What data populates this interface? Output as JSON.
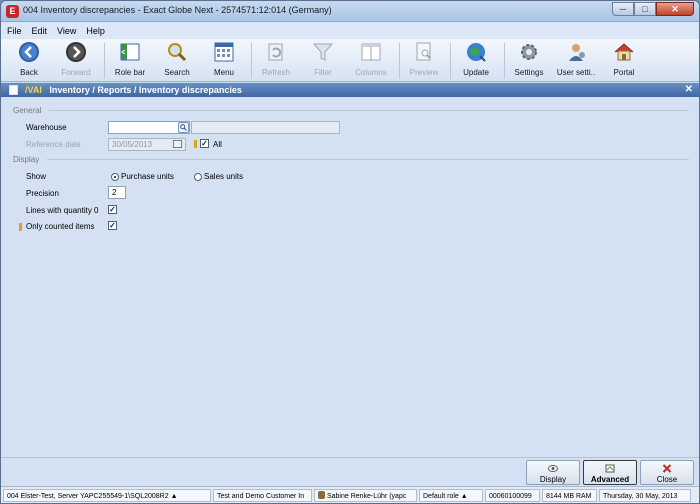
{
  "window": {
    "title": "004 Inventory discrepancies - Exact Globe Next - 2574571:12:014 (Germany)",
    "app_icon_letter": "E",
    "btn_min": "─",
    "btn_max": "□",
    "btn_close": "✕"
  },
  "menu": [
    "File",
    "Edit",
    "View",
    "Help"
  ],
  "toolbar": {
    "back": "Back",
    "forward": "Forward",
    "role_bar": "Role bar",
    "search": "Search",
    "menu": "Menu",
    "refresh": "Refresh",
    "filter": "Filter",
    "columns": "Columns",
    "preview": "Preview",
    "update": "Update",
    "settings": "Settings",
    "user_settings": "User setti..",
    "portal": "Portal"
  },
  "header": {
    "code": "/VAI",
    "path": "Inventory / Reports / Inventory discrepancies",
    "close": "✕"
  },
  "form": {
    "general_section": "General",
    "warehouse_label": "Warehouse",
    "warehouse_value": "",
    "reference_date_label": "Reference date",
    "reference_date_value": "30/05/2013",
    "all_label": "All",
    "all_checked": "✓",
    "display_section": "Display",
    "show_label": "Show",
    "purchase_units": "Purchase units",
    "sales_units": "Sales units",
    "precision_label": "Precision",
    "precision_value": "2",
    "lines_qty_zero_label": "Lines with quantity 0",
    "lines_qty_zero_checked": "✓",
    "only_counted_label": "Only counted items",
    "only_counted_checked": "✓"
  },
  "buttons": {
    "display": "Display",
    "advanced": "Advanced",
    "close": "Close"
  },
  "status": {
    "company": "004 Elster-Test, Server YAPC255549-1\\SQL2008R2",
    "company_arrow": "▲",
    "db": "Test and Demo Customer In",
    "user": "Sabine Renke-Lühr (yapc",
    "role": "Default role",
    "role_arrow": "▲",
    "account": "00060100099",
    "ram": "8144 MB RAM",
    "date": "Thursday, 30 May, 2013"
  },
  "colors": {
    "accent": "#3f66a3",
    "marker": "#d9a51a",
    "close_red": "#c62828"
  }
}
